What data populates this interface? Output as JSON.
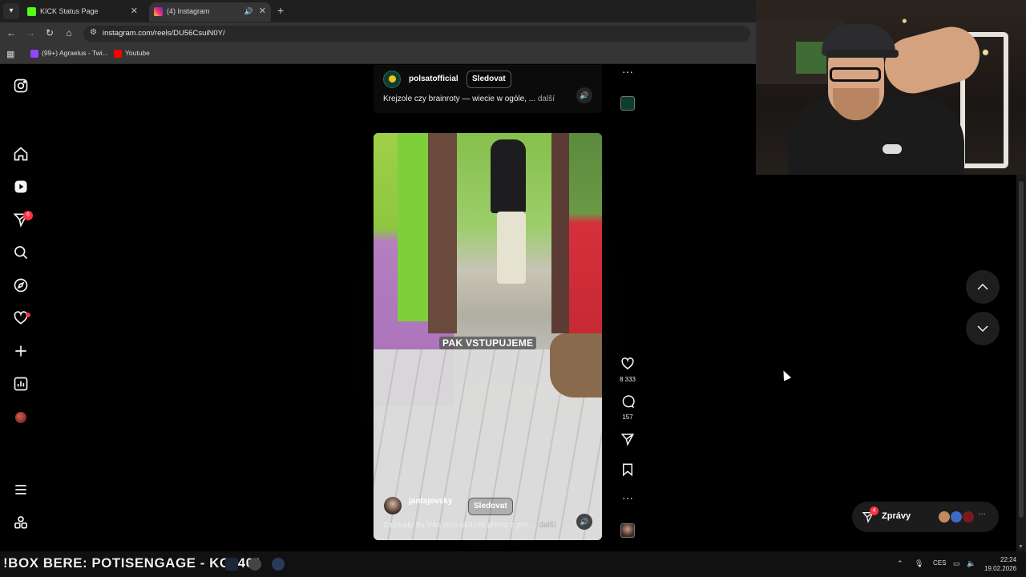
{
  "browser": {
    "tabs": [
      {
        "title": "KICK Status Page",
        "favicon": "kick-icon",
        "color": "#53fc18",
        "active": false
      },
      {
        "title": "(4) Instagram",
        "favicon": "instagram-icon",
        "color": "#e1306c",
        "active": true
      }
    ],
    "url": "instagram.com/reels/DU56CsuiN0Y/",
    "bookmarks": [
      {
        "label": "(99+) Agraelus - Twi...",
        "icon": "twitch-icon",
        "color": "#9146ff"
      },
      {
        "label": "Youtube",
        "icon": "youtube-icon",
        "color": "#ff0000"
      }
    ]
  },
  "instagram": {
    "sidebar": {
      "items": [
        "instagram-logo",
        "home",
        "reels",
        "messages",
        "search",
        "explore",
        "notifications",
        "create",
        "dashboard",
        "profile",
        "more",
        "also-from-meta"
      ],
      "messages_badge": "6"
    },
    "previous_post": {
      "username": "polsatofficial",
      "follow_label": "Sledovat",
      "caption": "Krejzole czy brainroty — wiecie w ogóle, ...",
      "more_label": "další"
    },
    "current_post": {
      "subtitle": "PAK VSTUPUJEME",
      "username": "jantajovsky",
      "follow_label": "Sledovat",
      "caption": "Zajímalo by Vás více ukázek přímo z pro ...",
      "more_label": "další",
      "likes": "8 333",
      "comments": "157"
    },
    "messages": {
      "label": "Zprávy",
      "badge": "4"
    }
  },
  "taskbar": {
    "ticker": "!BOX BERE: POTISENGAGE - KC1401",
    "language": "CES",
    "time": "22:24",
    "date": "19.02.2026"
  },
  "colors": {
    "accent_red": "#ff3040",
    "background": "#000000"
  }
}
